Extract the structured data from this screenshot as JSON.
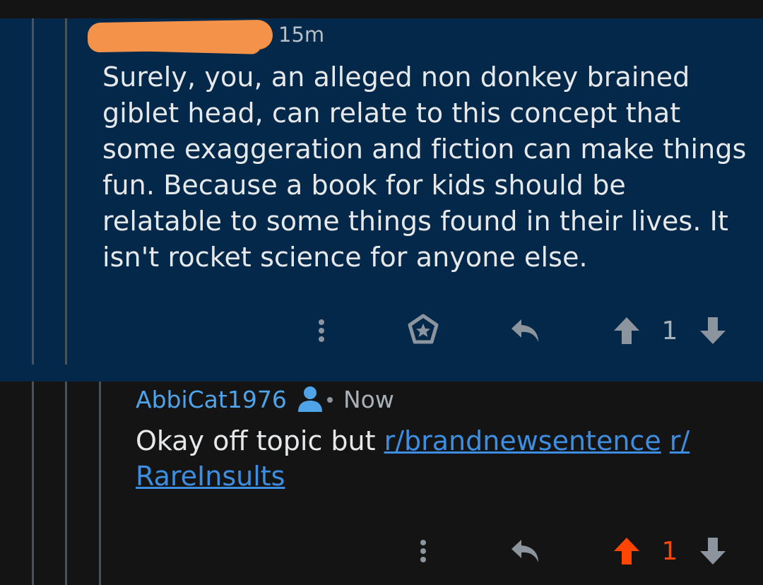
{
  "comment": {
    "timestamp": "15m",
    "body": "Surely, you, an alleged non donkey brained giblet head, can relate to this concept that some exaggeration and fiction can make things fun. Because a book for kids should be relatable to some things found in their lives. It isn't rocket science for anyone else.",
    "vote_count": "1",
    "icons": [
      "more-options-icon",
      "award-icon",
      "reply-icon",
      "upvote-icon",
      "downvote-icon"
    ]
  },
  "reply": {
    "username": "AbbiCat1976",
    "timestamp": "Now",
    "text_prefix": "Okay off topic but ",
    "link1": "r/brandnewsentence",
    "link2": "r/ RareInsults",
    "vote_count": "1",
    "icons": [
      "user-icon",
      "more-options-icon",
      "reply-icon",
      "upvote-icon",
      "downvote-icon"
    ]
  },
  "colors": {
    "background": "#141414",
    "highlight_background": "#032849",
    "username": "#4fa3e8",
    "link": "#3d8ee0",
    "upvoted": "#ff4500",
    "redaction": "#f5924a"
  }
}
